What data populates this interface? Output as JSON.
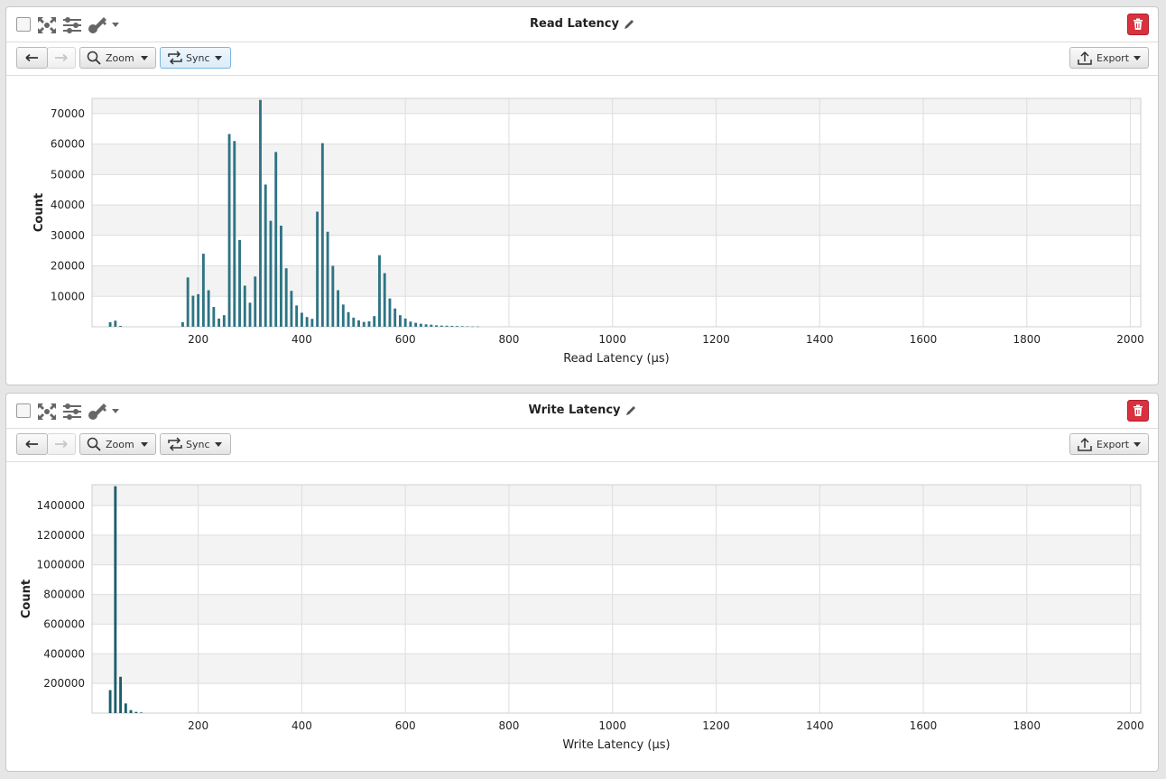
{
  "panels": [
    {
      "title": "Read Latency",
      "toolbar": {
        "zoom_label": "Zoom",
        "sync_label": "Sync",
        "export_label": "Export",
        "sync_active": true
      },
      "chart_data": {
        "type": "bar",
        "title": "Read Latency",
        "xlabel": "Read Latency (µs)",
        "ylabel": "Count",
        "xlim": [
          -5,
          2020
        ],
        "ylim": [
          0,
          75000
        ],
        "xticks": [
          200,
          400,
          600,
          800,
          1000,
          1200,
          1400,
          1600,
          1800,
          2000
        ],
        "yticks": [
          10000,
          20000,
          30000,
          40000,
          50000,
          60000,
          70000
        ],
        "bar_width": 5,
        "color": "#2e7484",
        "grid": true,
        "x": [
          30,
          40,
          50,
          170,
          180,
          190,
          200,
          210,
          220,
          230,
          240,
          250,
          260,
          270,
          280,
          290,
          300,
          310,
          320,
          330,
          340,
          350,
          360,
          370,
          380,
          390,
          400,
          410,
          420,
          430,
          440,
          450,
          460,
          470,
          480,
          490,
          500,
          510,
          520,
          530,
          540,
          550,
          560,
          570,
          580,
          590,
          600,
          610,
          620,
          630,
          640,
          650,
          660,
          670,
          680,
          690,
          700,
          710,
          720,
          730,
          740
        ],
        "values": [
          1500,
          2000,
          300,
          1500,
          16200,
          10200,
          10700,
          24000,
          12000,
          6500,
          2700,
          3800,
          63300,
          61000,
          28500,
          13500,
          7900,
          16500,
          74500,
          46700,
          34800,
          57400,
          33200,
          19200,
          11800,
          7000,
          4600,
          3200,
          2600,
          37800,
          60300,
          31200,
          20000,
          12000,
          7300,
          4800,
          3000,
          2100,
          1600,
          1800,
          3500,
          23500,
          17600,
          9300,
          6000,
          3800,
          2700,
          1700,
          1300,
          1000,
          800,
          700,
          500,
          400,
          350,
          300,
          250,
          200,
          150,
          100,
          80
        ]
      }
    },
    {
      "title": "Write Latency",
      "toolbar": {
        "zoom_label": "Zoom",
        "sync_label": "Sync",
        "export_label": "Export",
        "sync_active": false
      },
      "chart_data": {
        "type": "bar",
        "title": "Write Latency",
        "xlabel": "Write Latency (µs)",
        "ylabel": "Count",
        "xlim": [
          -5,
          2020
        ],
        "ylim": [
          0,
          1540000
        ],
        "xticks": [
          200,
          400,
          600,
          800,
          1000,
          1200,
          1400,
          1600,
          1800,
          2000
        ],
        "yticks": [
          200000,
          400000,
          600000,
          800000,
          1000000,
          1200000,
          1400000
        ],
        "bar_width": 5,
        "color": "#1c5d6c",
        "grid": true,
        "x": [
          30,
          40,
          50,
          60,
          70,
          80,
          90
        ],
        "values": [
          155000,
          1530000,
          245000,
          65000,
          20000,
          8000,
          4000
        ]
      }
    }
  ],
  "icons": [
    "checkbox-icon",
    "fit-screen-icon",
    "settings-sliders-icon",
    "key-icon",
    "pencil-icon",
    "trash-icon",
    "back-arrow-icon",
    "forward-arrow-icon",
    "search-icon",
    "sync-icon",
    "export-icon"
  ]
}
